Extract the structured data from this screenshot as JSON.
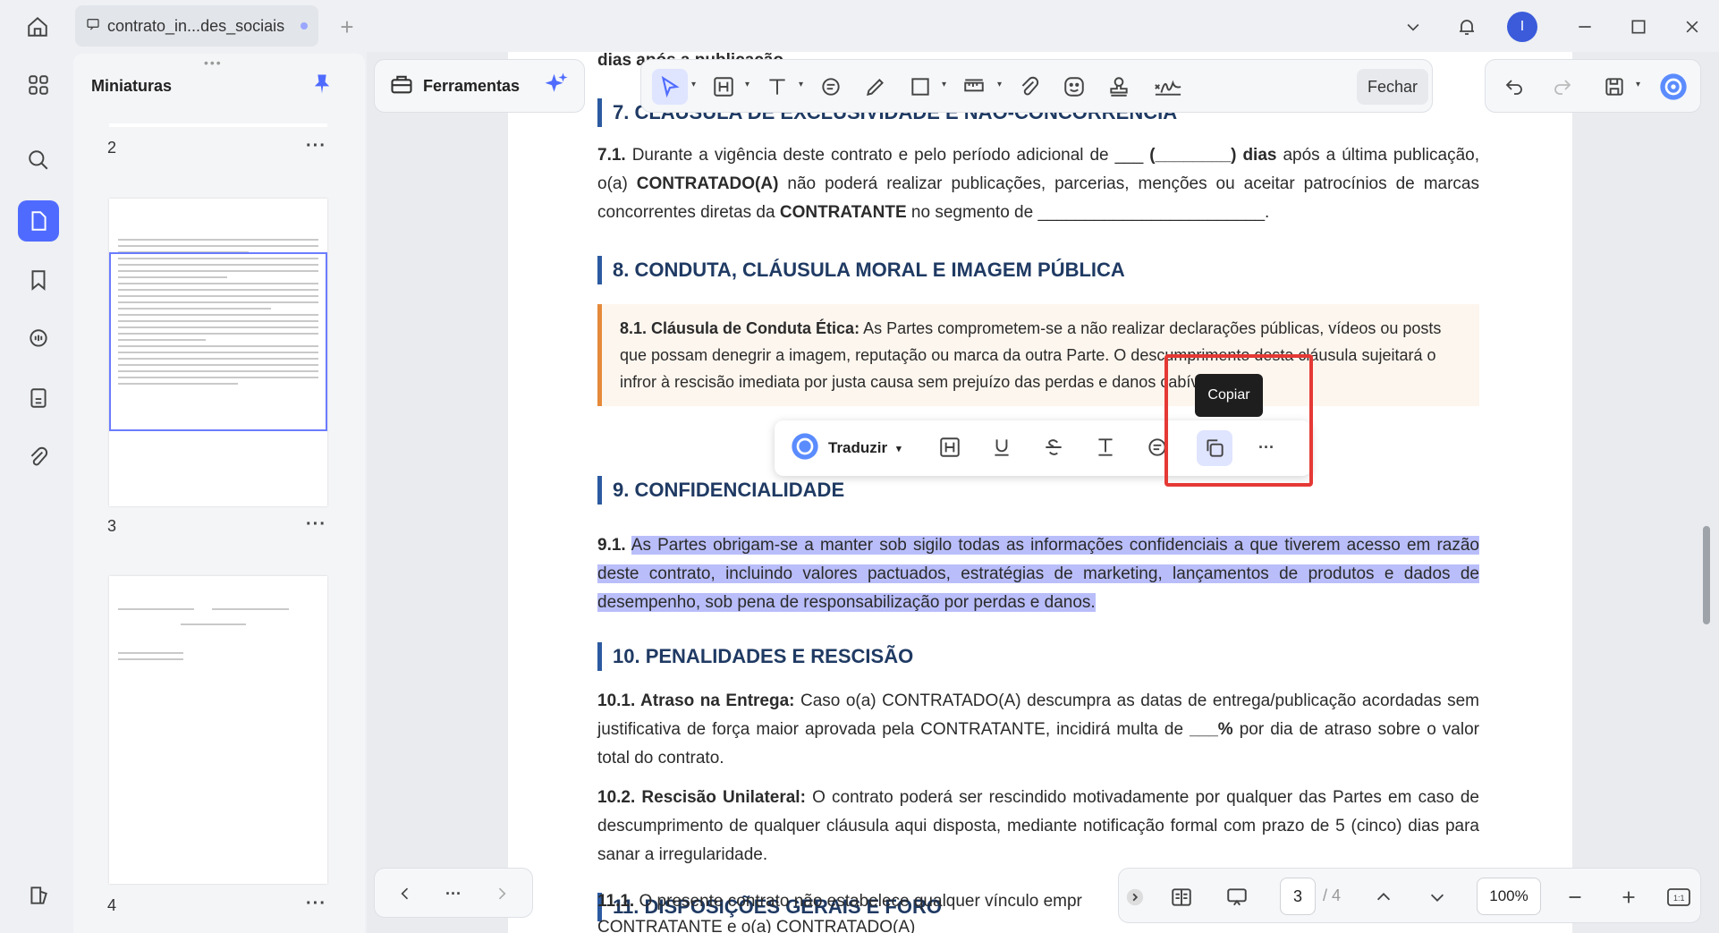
{
  "titlebar": {
    "tab_title": "contrato_in...des_sociais",
    "avatar_letter": "I"
  },
  "thumbnails": {
    "title": "Miniaturas",
    "pages": [
      "2",
      "3",
      "4"
    ],
    "more": "···"
  },
  "toolbar": {
    "tools_label": "Ferramentas",
    "close_label": "Fechar"
  },
  "document": {
    "cut_top": "dias após a publicação.",
    "s7_head": "7. CLÁUSULA DE EXCLUSIVIDADE E NÃO-CONCORRÊNCIA",
    "s7_1_num": "7.1.",
    "s7_1_a": "Durante a vigência deste contrato e pelo período adicional de ___ ",
    "s7_1_b": "(________) dias",
    "s7_1_c": " após a última publicação, o(a) ",
    "s7_1_d": "CONTRATADO(A)",
    "s7_1_e": " não poderá realizar publicações, parcerias, menções ou aceitar patrocínios de marcas concorrentes diretas da ",
    "s7_1_f": "CONTRATANTE",
    "s7_1_g": " no segmento de ________________________.",
    "s8_head": "8. CONDUTA, CLÁUSULA MORAL E IMAGEM PÚBLICA",
    "s8_1_title": "8.1. Cláusula de Conduta Ética:",
    "s8_1_text": " As Partes comprometem-se a não realizar declarações públicas, vídeos ou posts que possam denegrir a imagem, reputação ou marca da outra Parte. O descumprimento desta cláusula sujeitará o infror à rescisão imediata por justa causa sem prejuízo das perdas e danos cabíveis.",
    "s9_head": "9. CONFIDENCIALIDADE",
    "s9_1_num": "9.1.",
    "s9_1_text": "As Partes obrigam-se a manter sob sigilo todas as informações confidenciais a que tiverem acesso em razão deste contrato, incluindo valores pactuados, estratégias de marketing, lançamentos de produtos e dados de desempenho, sob pena de responsabilização por perdas e danos.",
    "s10_head": "10. PENALIDADES E RESCISÃO",
    "s10_1_title": "10.1. Atraso na Entrega:",
    "s10_1_a": " Caso o(a) CONTRATADO(A) descumpra as datas de entrega/publicação acordadas sem justificativa de força maior aprovada pela CONTRATANTE, incidirá multa de ",
    "s10_1_b": "___%",
    "s10_1_c": " por dia de atraso sobre o valor total do contrato.",
    "s10_2_title": "10.2. Rescisão Unilateral:",
    "s10_2_text": " O contrato poderá ser rescindido motivadamente por qualquer das Partes em caso de descumprimento de qualquer cláusula aqui disposta, mediante notificação formal com prazo de 5 (cinco) dias para sanar a irregularidade.",
    "s11_head": "11. DISPOSIÇÕES GERAIS E FORO",
    "s11_1_num": "11.1.",
    "s11_1_text": " O presente contrato não estabelece qualquer vínculo empr",
    "cut_bottom": "CONTRATANTE e o(a) CONTRATADO(A)"
  },
  "selection_toolbar": {
    "translate_label": "Traduzir",
    "tooltip": "Copiar",
    "more": "···"
  },
  "bottombar": {
    "left_more": "···",
    "current_page": "3",
    "total_pages": "/ 4",
    "zoom": "100%"
  },
  "colors": {
    "accent": "#4f6bff",
    "heading": "#1f3a63",
    "selection": "#b9befa",
    "annotation_box": "#e53935"
  }
}
